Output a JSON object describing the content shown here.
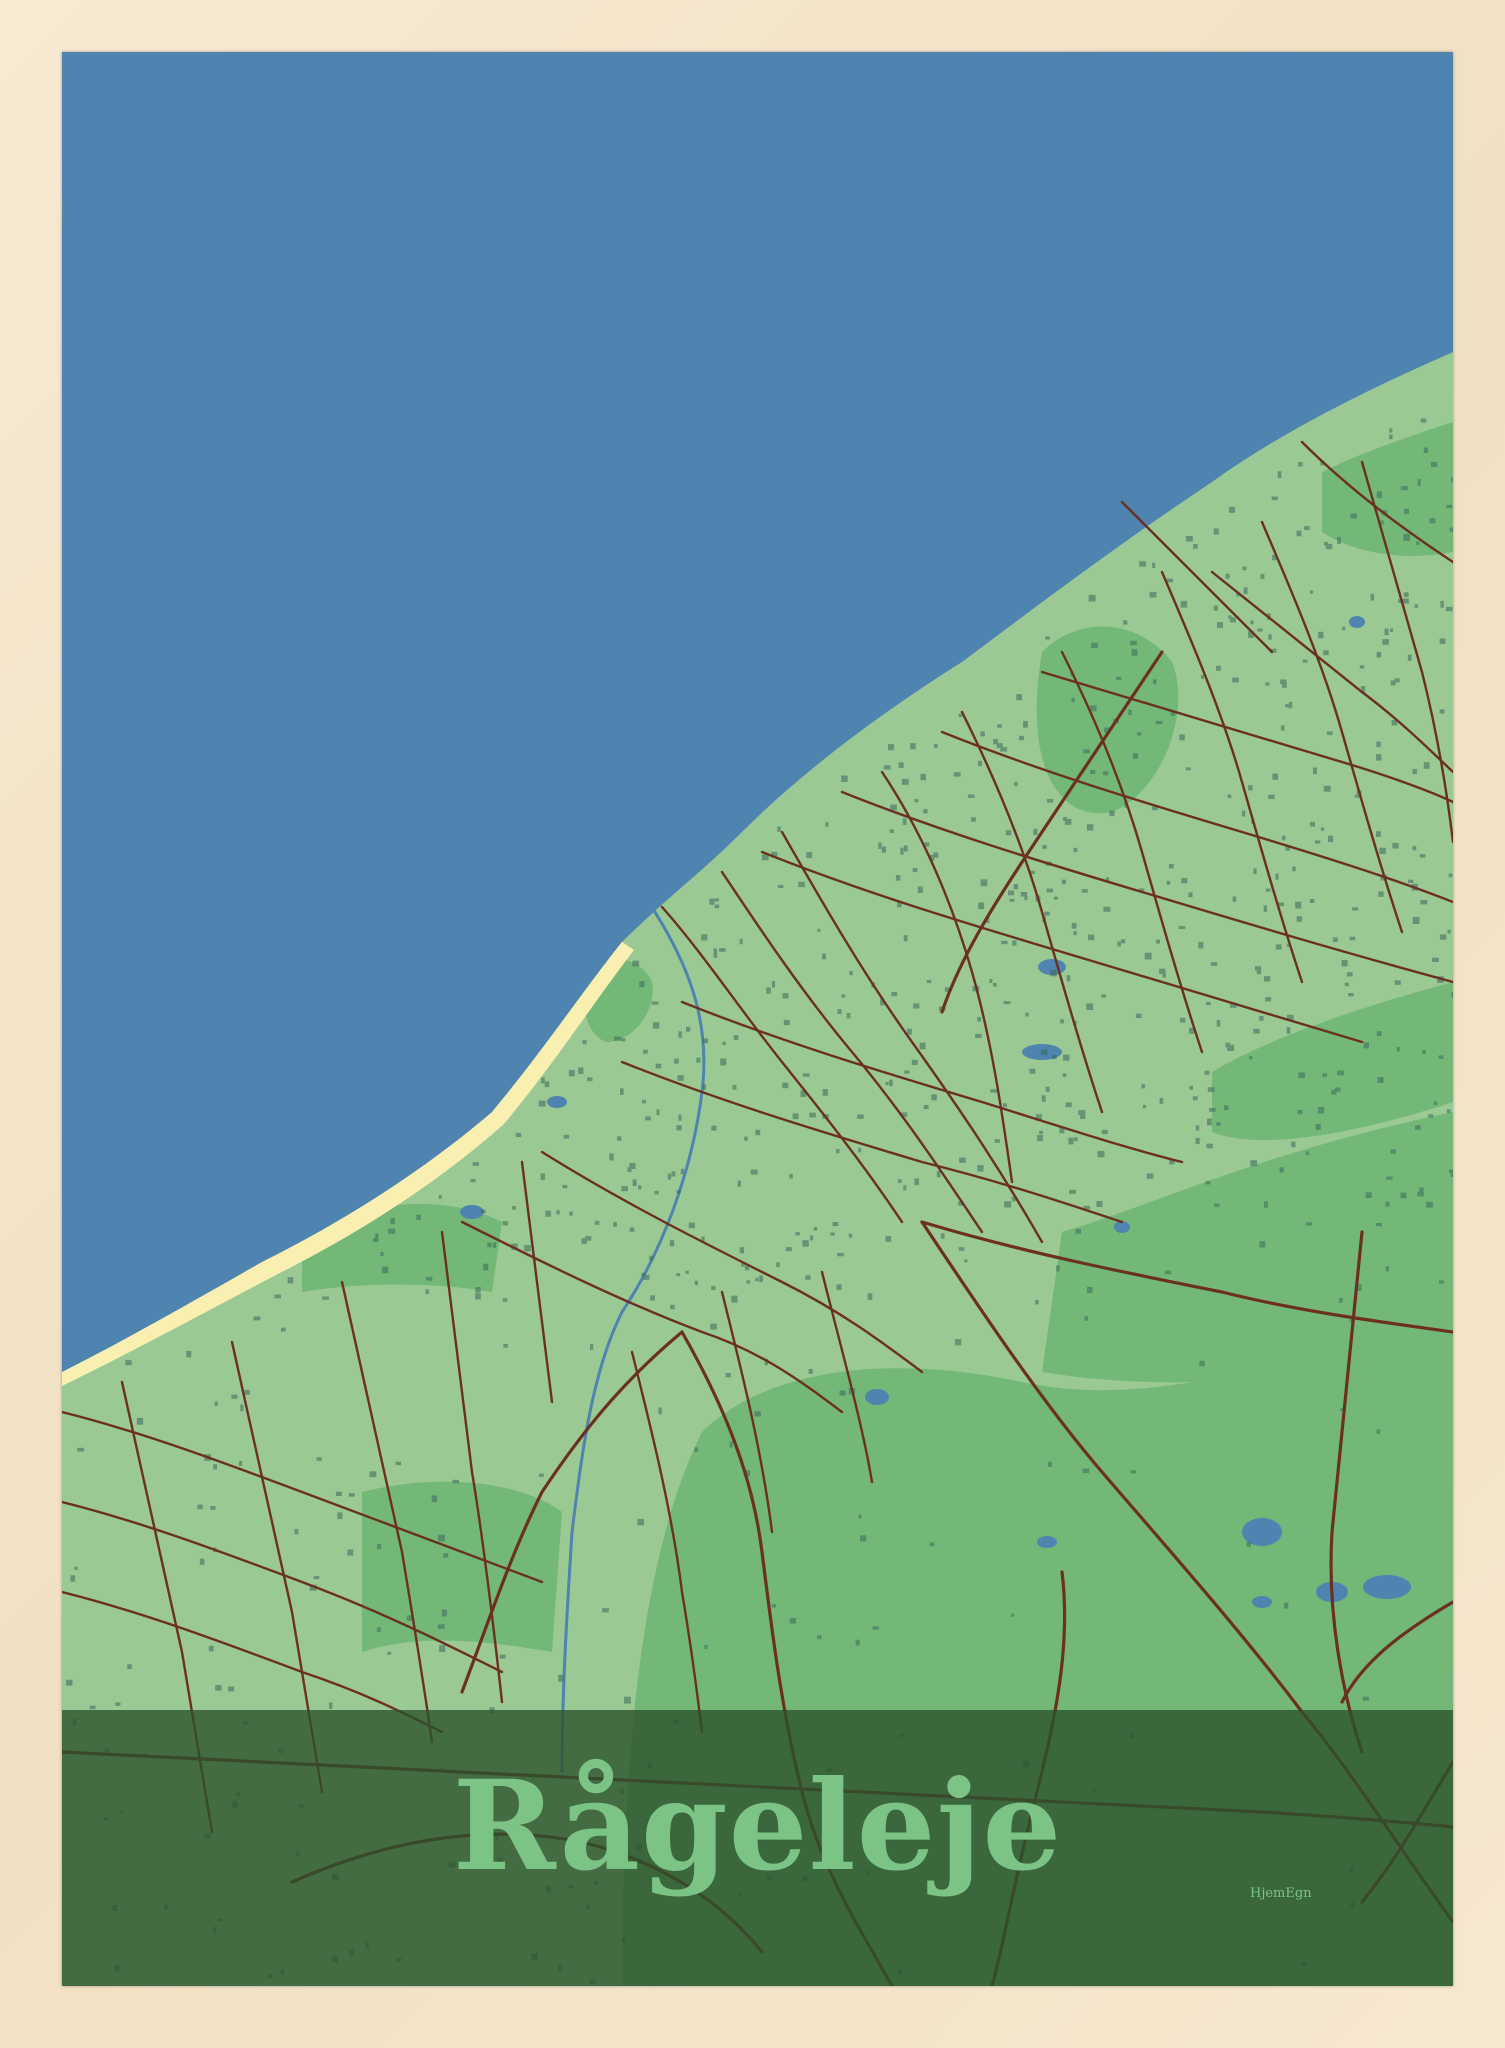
{
  "poster": {
    "title": "Rågeleje",
    "brand": "HjemEgn"
  },
  "colors": {
    "frame": "#f4e6cc",
    "sea": "#4f83b0",
    "land": "#9bc994",
    "park": "#74b877",
    "roads": "#6b3020",
    "buildings": "#3a6a5a",
    "lakes": "#4f83b0",
    "beach": "#f8efb0",
    "title_band": "#2a522c",
    "title_text": "#7cc486"
  }
}
